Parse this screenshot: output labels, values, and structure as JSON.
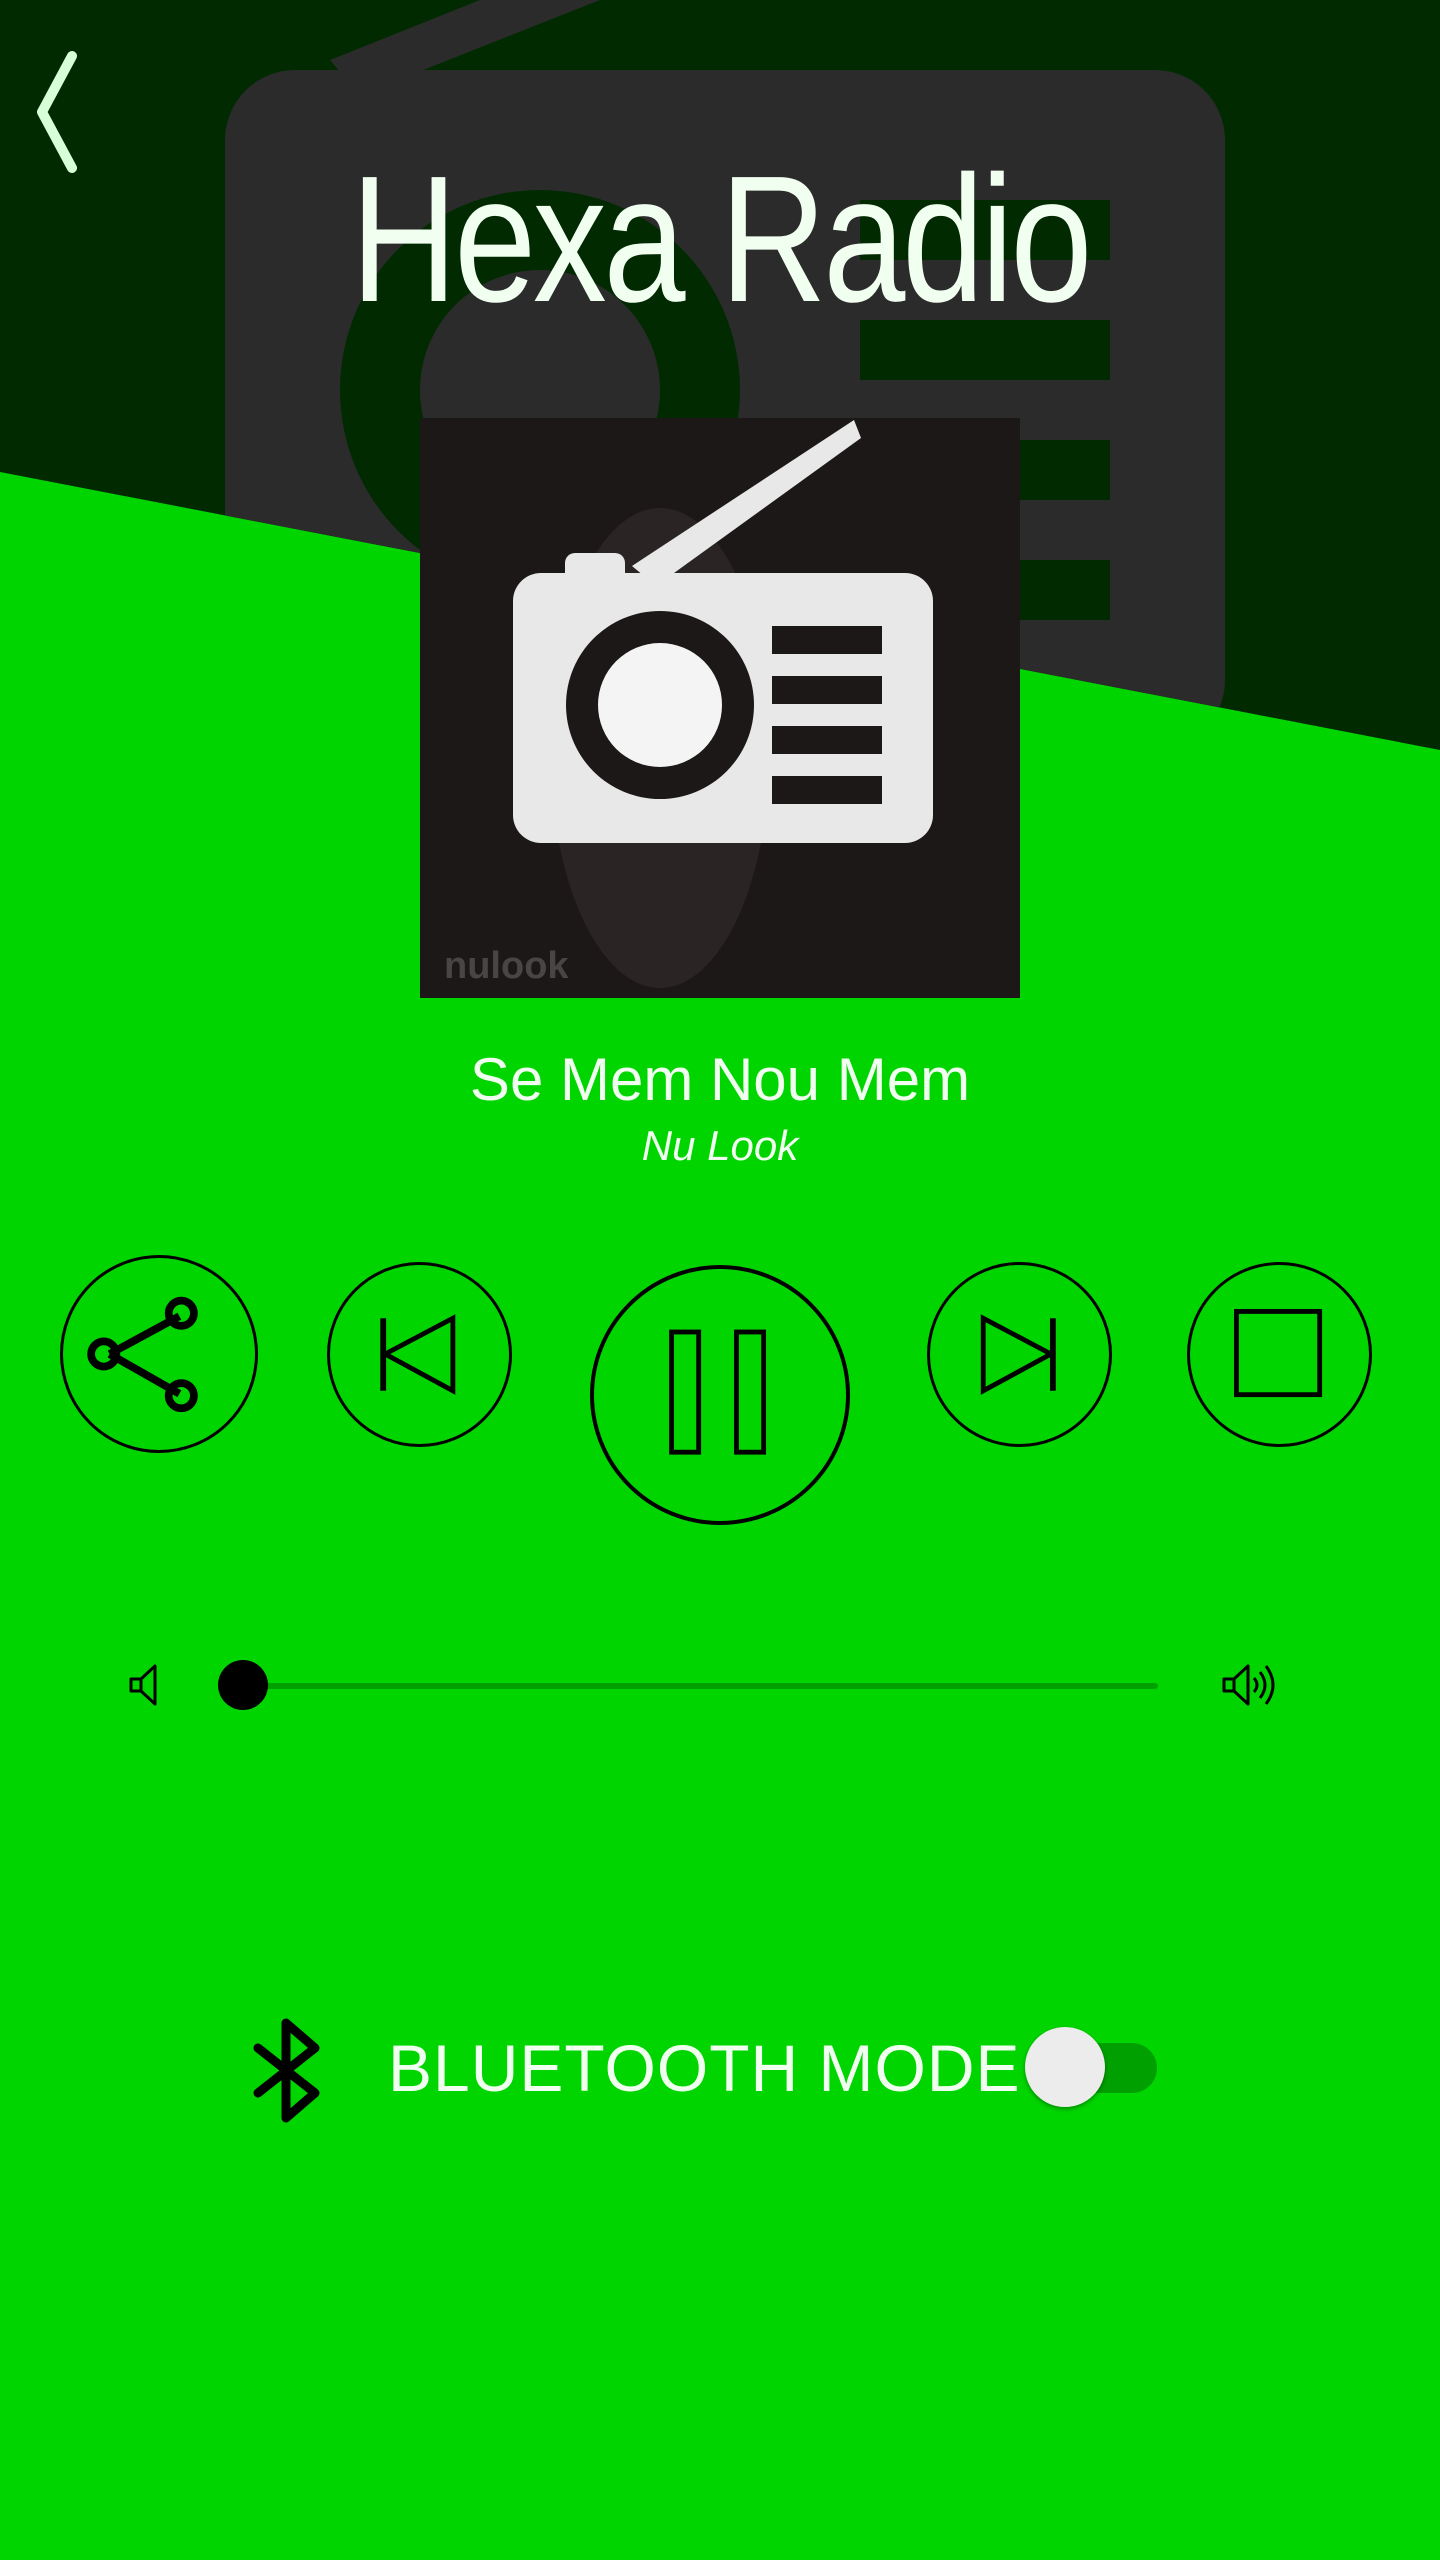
{
  "header": {
    "title": "Hexa Radio",
    "back_icon": "chevron-left-icon"
  },
  "now_playing": {
    "album_art_watermark": "nulook",
    "song_title": "Se Mem Nou Mem",
    "artist": "Nu Look"
  },
  "controls": {
    "share_icon": "share-icon",
    "previous_icon": "skip-previous-icon",
    "pause_icon": "pause-icon",
    "next_icon": "skip-next-icon",
    "stop_icon": "stop-icon"
  },
  "volume": {
    "level_fraction": 0.0,
    "low_icon": "volume-low-icon",
    "high_icon": "volume-high-icon"
  },
  "bluetooth": {
    "label": "BLUETOOTH MODE",
    "enabled": false,
    "icon": "bluetooth-icon"
  },
  "colors": {
    "background": "#00d500",
    "header_band": "#012a01",
    "text": "#f0fff0",
    "controls": "#000000",
    "track": "#00a000"
  }
}
